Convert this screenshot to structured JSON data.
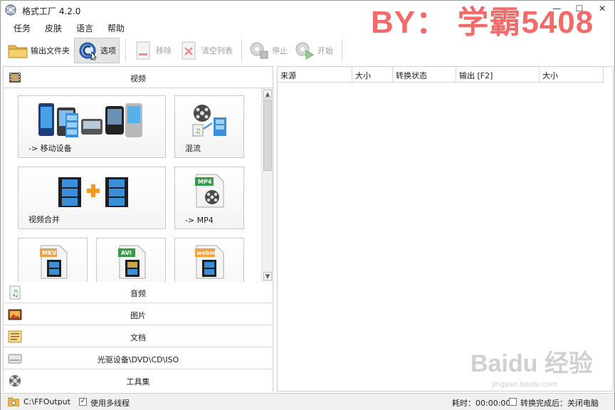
{
  "window": {
    "title": "格式工厂 4.2.0",
    "controls": [
      "—",
      "☐",
      "✕"
    ]
  },
  "watermark": "BY： 学霸5408",
  "menu": [
    "任务",
    "皮肤",
    "语言",
    "帮助"
  ],
  "toolbar": {
    "output_folder": "输出文件夹",
    "options": "选项",
    "remove": "移除",
    "clear_list": "清空列表",
    "stop": "停止",
    "start": "开始"
  },
  "categories": {
    "video": "视频",
    "audio": "音频",
    "picture": "图片",
    "document": "文档",
    "rom": "光驱设备\\DVD\\CD\\ISO",
    "tools": "工具集"
  },
  "video_tiles": {
    "mobile": "-> 移动设备",
    "mux": "混流",
    "join": "视频合并",
    "mp4": "-> MP4",
    "mkv_badge": "MKV",
    "avi_badge": "AVI",
    "webm_badge": "webm",
    "mp4_badge": "MP4"
  },
  "columns": [
    "来源",
    "大小",
    "转换状态",
    "输出 [F2]",
    "大小"
  ],
  "statusbar": {
    "path": "C:\\FFOutput",
    "multithread": "使用多线程",
    "elapsed": "耗时：00:00:00",
    "after_done": "转换完成后：关闭电脑"
  },
  "baidu": {
    "logo": "Baidu 经验",
    "url": "jingyan.baidu.com"
  },
  "colors": {
    "watermark": "#f26b6b",
    "film_blue": "#3b8fd9",
    "plus_orange": "#f29a1e"
  }
}
